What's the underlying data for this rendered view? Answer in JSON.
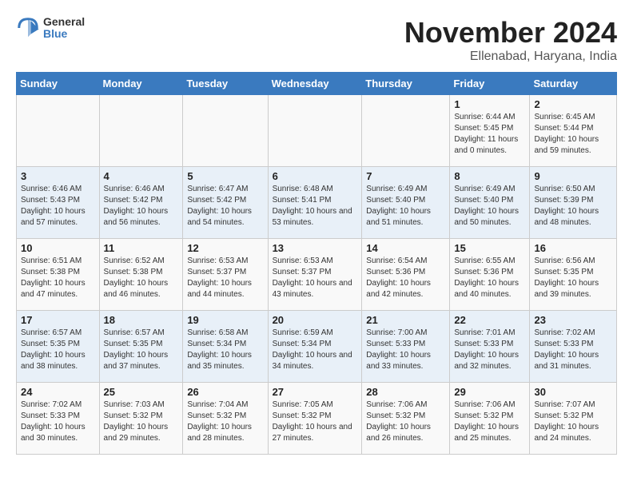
{
  "logo": {
    "general": "General",
    "blue": "Blue"
  },
  "title": "November 2024",
  "location": "Ellenabad, Haryana, India",
  "days_of_week": [
    "Sunday",
    "Monday",
    "Tuesday",
    "Wednesday",
    "Thursday",
    "Friday",
    "Saturday"
  ],
  "weeks": [
    [
      {
        "day": "",
        "sunrise": "",
        "sunset": "",
        "daylight": ""
      },
      {
        "day": "",
        "sunrise": "",
        "sunset": "",
        "daylight": ""
      },
      {
        "day": "",
        "sunrise": "",
        "sunset": "",
        "daylight": ""
      },
      {
        "day": "",
        "sunrise": "",
        "sunset": "",
        "daylight": ""
      },
      {
        "day": "",
        "sunrise": "",
        "sunset": "",
        "daylight": ""
      },
      {
        "day": "1",
        "sunrise": "Sunrise: 6:44 AM",
        "sunset": "Sunset: 5:45 PM",
        "daylight": "Daylight: 11 hours and 0 minutes."
      },
      {
        "day": "2",
        "sunrise": "Sunrise: 6:45 AM",
        "sunset": "Sunset: 5:44 PM",
        "daylight": "Daylight: 10 hours and 59 minutes."
      }
    ],
    [
      {
        "day": "3",
        "sunrise": "Sunrise: 6:46 AM",
        "sunset": "Sunset: 5:43 PM",
        "daylight": "Daylight: 10 hours and 57 minutes."
      },
      {
        "day": "4",
        "sunrise": "Sunrise: 6:46 AM",
        "sunset": "Sunset: 5:42 PM",
        "daylight": "Daylight: 10 hours and 56 minutes."
      },
      {
        "day": "5",
        "sunrise": "Sunrise: 6:47 AM",
        "sunset": "Sunset: 5:42 PM",
        "daylight": "Daylight: 10 hours and 54 minutes."
      },
      {
        "day": "6",
        "sunrise": "Sunrise: 6:48 AM",
        "sunset": "Sunset: 5:41 PM",
        "daylight": "Daylight: 10 hours and 53 minutes."
      },
      {
        "day": "7",
        "sunrise": "Sunrise: 6:49 AM",
        "sunset": "Sunset: 5:40 PM",
        "daylight": "Daylight: 10 hours and 51 minutes."
      },
      {
        "day": "8",
        "sunrise": "Sunrise: 6:49 AM",
        "sunset": "Sunset: 5:40 PM",
        "daylight": "Daylight: 10 hours and 50 minutes."
      },
      {
        "day": "9",
        "sunrise": "Sunrise: 6:50 AM",
        "sunset": "Sunset: 5:39 PM",
        "daylight": "Daylight: 10 hours and 48 minutes."
      }
    ],
    [
      {
        "day": "10",
        "sunrise": "Sunrise: 6:51 AM",
        "sunset": "Sunset: 5:38 PM",
        "daylight": "Daylight: 10 hours and 47 minutes."
      },
      {
        "day": "11",
        "sunrise": "Sunrise: 6:52 AM",
        "sunset": "Sunset: 5:38 PM",
        "daylight": "Daylight: 10 hours and 46 minutes."
      },
      {
        "day": "12",
        "sunrise": "Sunrise: 6:53 AM",
        "sunset": "Sunset: 5:37 PM",
        "daylight": "Daylight: 10 hours and 44 minutes."
      },
      {
        "day": "13",
        "sunrise": "Sunrise: 6:53 AM",
        "sunset": "Sunset: 5:37 PM",
        "daylight": "Daylight: 10 hours and 43 minutes."
      },
      {
        "day": "14",
        "sunrise": "Sunrise: 6:54 AM",
        "sunset": "Sunset: 5:36 PM",
        "daylight": "Daylight: 10 hours and 42 minutes."
      },
      {
        "day": "15",
        "sunrise": "Sunrise: 6:55 AM",
        "sunset": "Sunset: 5:36 PM",
        "daylight": "Daylight: 10 hours and 40 minutes."
      },
      {
        "day": "16",
        "sunrise": "Sunrise: 6:56 AM",
        "sunset": "Sunset: 5:35 PM",
        "daylight": "Daylight: 10 hours and 39 minutes."
      }
    ],
    [
      {
        "day": "17",
        "sunrise": "Sunrise: 6:57 AM",
        "sunset": "Sunset: 5:35 PM",
        "daylight": "Daylight: 10 hours and 38 minutes."
      },
      {
        "day": "18",
        "sunrise": "Sunrise: 6:57 AM",
        "sunset": "Sunset: 5:35 PM",
        "daylight": "Daylight: 10 hours and 37 minutes."
      },
      {
        "day": "19",
        "sunrise": "Sunrise: 6:58 AM",
        "sunset": "Sunset: 5:34 PM",
        "daylight": "Daylight: 10 hours and 35 minutes."
      },
      {
        "day": "20",
        "sunrise": "Sunrise: 6:59 AM",
        "sunset": "Sunset: 5:34 PM",
        "daylight": "Daylight: 10 hours and 34 minutes."
      },
      {
        "day": "21",
        "sunrise": "Sunrise: 7:00 AM",
        "sunset": "Sunset: 5:33 PM",
        "daylight": "Daylight: 10 hours and 33 minutes."
      },
      {
        "day": "22",
        "sunrise": "Sunrise: 7:01 AM",
        "sunset": "Sunset: 5:33 PM",
        "daylight": "Daylight: 10 hours and 32 minutes."
      },
      {
        "day": "23",
        "sunrise": "Sunrise: 7:02 AM",
        "sunset": "Sunset: 5:33 PM",
        "daylight": "Daylight: 10 hours and 31 minutes."
      }
    ],
    [
      {
        "day": "24",
        "sunrise": "Sunrise: 7:02 AM",
        "sunset": "Sunset: 5:33 PM",
        "daylight": "Daylight: 10 hours and 30 minutes."
      },
      {
        "day": "25",
        "sunrise": "Sunrise: 7:03 AM",
        "sunset": "Sunset: 5:32 PM",
        "daylight": "Daylight: 10 hours and 29 minutes."
      },
      {
        "day": "26",
        "sunrise": "Sunrise: 7:04 AM",
        "sunset": "Sunset: 5:32 PM",
        "daylight": "Daylight: 10 hours and 28 minutes."
      },
      {
        "day": "27",
        "sunrise": "Sunrise: 7:05 AM",
        "sunset": "Sunset: 5:32 PM",
        "daylight": "Daylight: 10 hours and 27 minutes."
      },
      {
        "day": "28",
        "sunrise": "Sunrise: 7:06 AM",
        "sunset": "Sunset: 5:32 PM",
        "daylight": "Daylight: 10 hours and 26 minutes."
      },
      {
        "day": "29",
        "sunrise": "Sunrise: 7:06 AM",
        "sunset": "Sunset: 5:32 PM",
        "daylight": "Daylight: 10 hours and 25 minutes."
      },
      {
        "day": "30",
        "sunrise": "Sunrise: 7:07 AM",
        "sunset": "Sunset: 5:32 PM",
        "daylight": "Daylight: 10 hours and 24 minutes."
      }
    ]
  ]
}
